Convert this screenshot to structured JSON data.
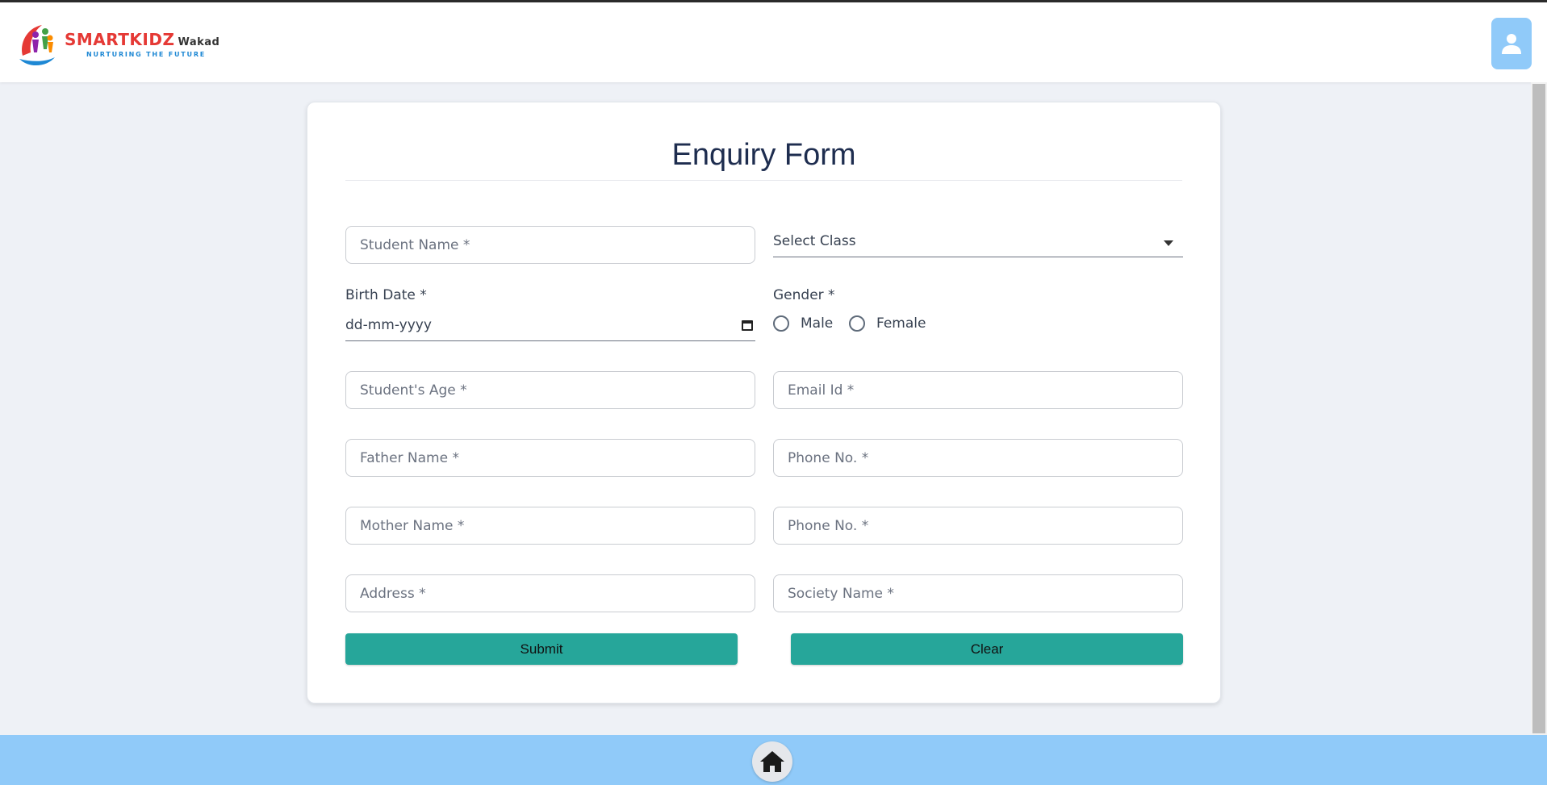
{
  "header": {
    "logo": {
      "brand": "SMARTKIDZ",
      "location": "Wakad",
      "tagline": "NURTURING THE FUTURE"
    },
    "user_icon": "user-icon"
  },
  "form": {
    "title": "Enquiry Form",
    "student_name_placeholder": "Student Name *",
    "select_class_value": "Select Class",
    "birth_date_label": "Birth Date *",
    "birth_date_value": "dd-mm-yyyy",
    "gender_label": "Gender *",
    "gender_options": [
      "Male",
      "Female"
    ],
    "student_age_placeholder": "Student's Age *",
    "email_placeholder": "Email Id *",
    "father_name_placeholder": "Father Name *",
    "father_phone_placeholder": "Phone No. *",
    "mother_name_placeholder": "Mother Name *",
    "mother_phone_placeholder": "Phone No. *",
    "address_placeholder": "Address *",
    "society_placeholder": "Society Name *",
    "submit_label": "Submit",
    "clear_label": "Clear"
  },
  "footer": {
    "home_icon": "home-icon"
  },
  "colors": {
    "accent_button": "#26a69a",
    "header_user_button": "#90caf9",
    "footer_bar": "#90caf9",
    "title_text": "#1e2d4f",
    "page_background": "#eef1f6"
  }
}
